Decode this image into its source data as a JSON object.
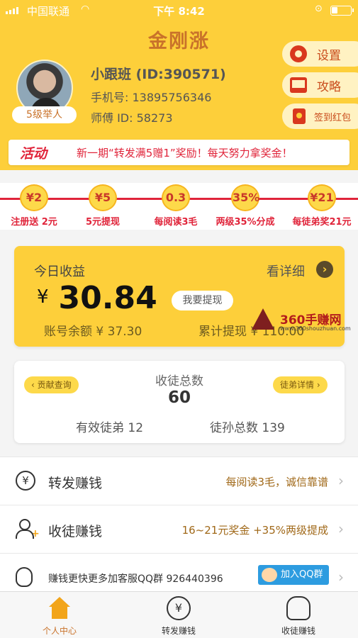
{
  "status_bar": {
    "carrier": "中国联通",
    "time": "下午 8:42"
  },
  "app": {
    "title": "金刚涨"
  },
  "profile": {
    "level": "5级举人",
    "name": "小跟班 (ID:390571)",
    "phone": "手机号: 13895756346",
    "master": "师傅 ID: 58273"
  },
  "side_buttons": {
    "settings": "设置",
    "guide": "攻略",
    "red_packet": "签到红包"
  },
  "banner": {
    "tag": "活动",
    "text": "新一期“转发满5赠1”奖励！每天努力拿奖金！"
  },
  "steps": [
    {
      "coin": "¥2",
      "label": "注册送 2元"
    },
    {
      "coin": "¥5",
      "label": "5元提现"
    },
    {
      "coin": "0.3",
      "label": "每阅读3毛"
    },
    {
      "coin": "35%",
      "label": "两级35%分成"
    },
    {
      "coin": "¥21",
      "label": "每徒弟奖21元"
    }
  ],
  "earnings": {
    "title": "今日收益",
    "detail_link": "看详细",
    "currency": "¥",
    "amount": "30.84",
    "withdraw_button": "我要提现",
    "balance": "账号余额 ¥ 37.30",
    "withdrawn": "累计提现 ¥ 110.00"
  },
  "watermark": {
    "title": "360手赚网",
    "url": "www.360shouzhuan.com"
  },
  "apprentices": {
    "contribution_button": "贡献查询",
    "detail_button": "徒弟详情",
    "label": "收徒总数",
    "count": "60",
    "valid": "有效徒弟 12",
    "grand": "徒孙总数 139"
  },
  "list": {
    "share": {
      "title": "转发赚钱",
      "note": "每阅读3毛，诚信靠谱"
    },
    "recruit": {
      "title": "收徒赚钱",
      "note": "16~21元奖金 +35%两级提成"
    },
    "qq": {
      "text": "赚钱更快更多加客服QQ群 926440396",
      "button": "加入QQ群"
    }
  },
  "tabs": [
    {
      "label": "个人中心"
    },
    {
      "label": "转发赚钱"
    },
    {
      "label": "收徒赚钱"
    }
  ],
  "colors": {
    "accent": "#fdcf3a",
    "brand_text": "#c9722a",
    "highlight_red": "#e0243a"
  }
}
